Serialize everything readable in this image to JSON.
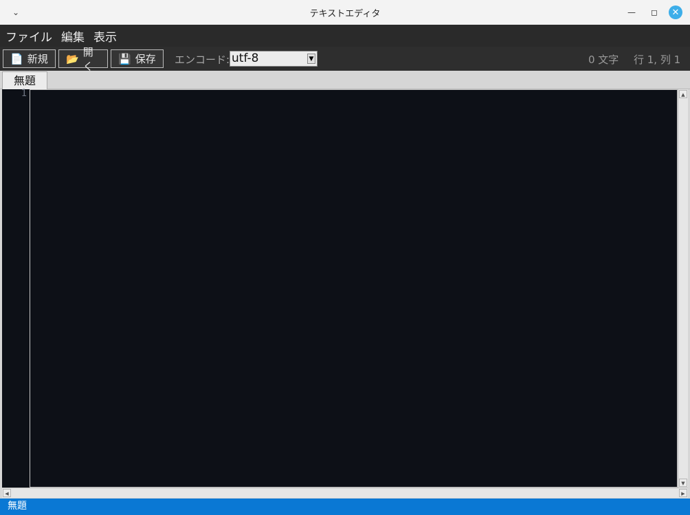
{
  "window": {
    "title": "テキストエディタ",
    "menu_icon": "chevron-down-icon",
    "minimize_icon": "minimize-icon",
    "maximize_icon": "maximize-icon",
    "close_icon": "close-icon",
    "close_color": "#3daee9"
  },
  "menubar": {
    "items": [
      {
        "label": "ファイル"
      },
      {
        "label": "編集"
      },
      {
        "label": "表示"
      }
    ]
  },
  "toolbar": {
    "new_label": "新規",
    "new_icon": "new-file-icon",
    "open_label": "開く",
    "open_icon": "folder-open-icon",
    "save_label": "保存",
    "save_icon": "floppy-disk-icon",
    "encoding_label": "エンコード:",
    "encoding_value": "utf-8",
    "char_count": "0 文字",
    "cursor_position": "行 1, 列 1"
  },
  "tabs": [
    {
      "label": "無題",
      "active": true
    }
  ],
  "editor": {
    "line_numbers": [
      "1"
    ],
    "content": "",
    "background": "#0d1017"
  },
  "statusbar": {
    "text": "無題",
    "color": "#0a78d4"
  }
}
